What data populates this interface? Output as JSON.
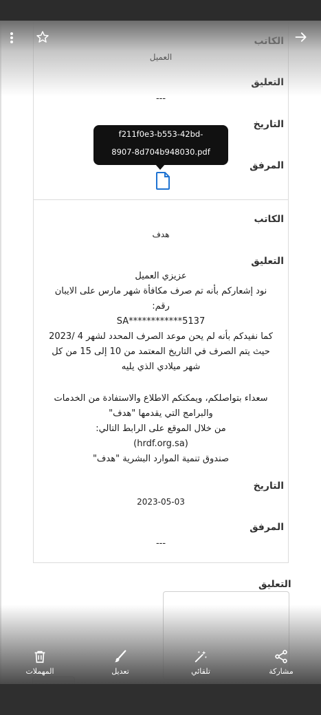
{
  "viewer": {
    "icons": {
      "more": "more-vert-icon",
      "star": "star-outline-icon",
      "back": "arrow-forward-icon"
    }
  },
  "card1": {
    "author_label": "الكاتب",
    "author_value": "العميل",
    "comment_label": "التعليق",
    "comment_value": "---",
    "date_label": "التاريخ",
    "attachment_label": "المرفق",
    "tooltip": [
      "f211f0e3-b553-42bd-",
      "8907-8d704b948030.pdf"
    ]
  },
  "card2": {
    "author_label": "الكاتب",
    "author_value": "هدف",
    "comment_label": "التعليق",
    "message_1": [
      "عزيزي العميل",
      "نود إشعاركم بأنه تم صرف مكافأة شهر مارس على الايبان",
      "رقم:",
      "SA************5137",
      "كما نفيدكم بأنه لم يحن موعد الصرف المحدد لشهر 4 /2023",
      "حيث يتم الصرف في التاريخ المعتمد من 10 إلى 15 من كل",
      "شهر ميلادي الذي يليه"
    ],
    "message_2": [
      "سعداء بتواصلكم، ويمكنكم الاطلاع والاستفادة من الخدمات",
      "والبرامج التي يقدمها \"هدف\"",
      "من خلال الموقع على الرابط التالي:",
      "(hrdf.org.sa)",
      "صندوق تنمية الموارد البشرية \"هدف\""
    ],
    "date_label": "التاريخ",
    "date_value": "2023-05-03",
    "attachment_label": "المرفق",
    "attachment_value": "---"
  },
  "comment": {
    "label": "التعليق"
  },
  "toolbar": {
    "share": "مشاركة",
    "auto": "تلقائي",
    "edit": "تعديل",
    "trash": "المهملات"
  }
}
